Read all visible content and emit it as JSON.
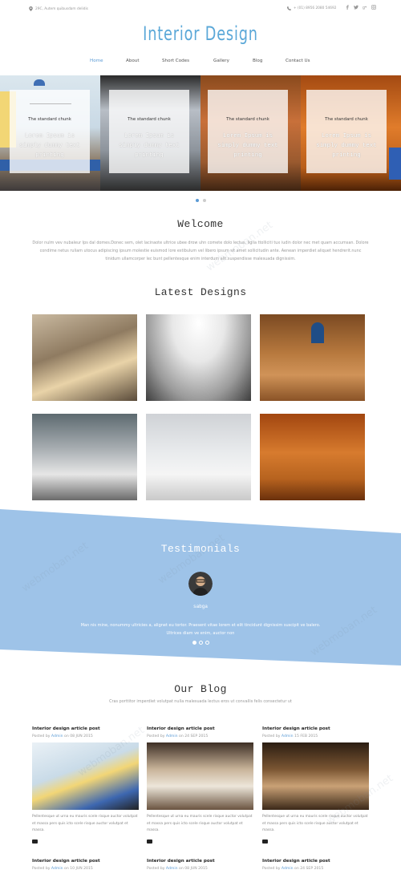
{
  "topbar": {
    "address": "29C, Autem quibusdam delidis",
    "phone": "+ (01) 8956 2080 54692",
    "social_icons": [
      "facebook-icon",
      "twitter-icon",
      "google-plus-icon",
      "instagram-icon"
    ]
  },
  "logo": "Interior Design",
  "nav": [
    {
      "label": "Home",
      "active": true
    },
    {
      "label": "About",
      "active": false
    },
    {
      "label": "Short Codes",
      "active": false
    },
    {
      "label": "Gallery",
      "active": false
    },
    {
      "label": "Blog",
      "active": false
    },
    {
      "label": "Contact Us",
      "active": false
    }
  ],
  "slider": {
    "cards": [
      {
        "title": "The standard chunk",
        "text": "Lorem Ipsum is simply dummy text printing"
      },
      {
        "title": "The standard chunk",
        "text": "Lorem Ipsum is simply dummy text printing"
      },
      {
        "title": "The standard chunk",
        "text": "Lorem Ipsum is simply dummy text printing"
      },
      {
        "title": "The standard chunk",
        "text": "Lorem Ipsum is simply dummy text printing"
      }
    ],
    "dots": 2,
    "active_dot": 0
  },
  "welcome": {
    "heading": "Welcome",
    "text": "Dolor nulm vev nubaleur Ips dal domes.Donec sem, olet lacinaote ultrice ubee drow uhn comete dolo lectus, ligila ttolliciti tux iudin dolor nec met quam accumsan. Dolore condime netus ruliam utocus adipiscing ipsum molestie euismod lore estibulum vel libero ipsum sit amet sollicitudin ante. Aenean imperdiet aliquet hendrerit.nunc tinidum ullamcorper lec bunt pellentesque enim interdum alit.suspendisse malesuada dignissim."
  },
  "latest": {
    "heading": "Latest Designs"
  },
  "testimonials": {
    "heading": "Testimonials",
    "name": "sabga",
    "quote": "Man nis mine, nonummy ultricies a, alignet eu tortor. Praesent vitae lorem et elit tincidunt dignissim suscipit ve balero. Ultrices diam ve enim, auctor non",
    "dots": 3,
    "active_dot": 0,
    "band_color": "#9ec3e8"
  },
  "blog": {
    "heading": "Our Blog",
    "subtitle": "Cras porttitor imperdiet volutpat nulla malesuada lectus eros ut convallis felis consectetur ut",
    "posts": [
      {
        "title": "Interior design article post",
        "posted": "Posted by",
        "author": "Admin",
        "on": "on 08 JUN 2015",
        "excerpt": "Pellentesque ut urna eu mauris scele risque auctor volutpat et massa pers quis icto scele risque auctor volutpat et massa."
      },
      {
        "title": "Interior design article post",
        "posted": "Posted by",
        "author": "Admin",
        "on": "on 24 SEP 2015",
        "excerpt": "Pellentesque ut urna eu mauris scele risque auctor volutpat et massa pers quis icto scele risque auctor volutpat et massa."
      },
      {
        "title": "Interior design article post",
        "posted": "Posted by",
        "author": "Admin",
        "on": "15 FEB 2015",
        "excerpt": "Pellentesque ut urna eu mauris scele risque auctor volutpat et massa pers quis icto scele risque auctor volutpat et massa."
      },
      {
        "title": "Interior design article post",
        "posted": "Posted by",
        "author": "Admin",
        "on": "on 10 JUN 2015",
        "excerpt": ""
      },
      {
        "title": "Interior design article post",
        "posted": "Posted by",
        "author": "Admin",
        "on": "on 08 JUN 2015",
        "excerpt": ""
      },
      {
        "title": "Interior design article post",
        "posted": "Posted by",
        "author": "Admin",
        "on": "on 24 SEP 2015",
        "excerpt": ""
      }
    ]
  },
  "watermark": "webmoban.net",
  "colors": {
    "accent": "#5b9bd5",
    "band": "#9ec3e8"
  }
}
